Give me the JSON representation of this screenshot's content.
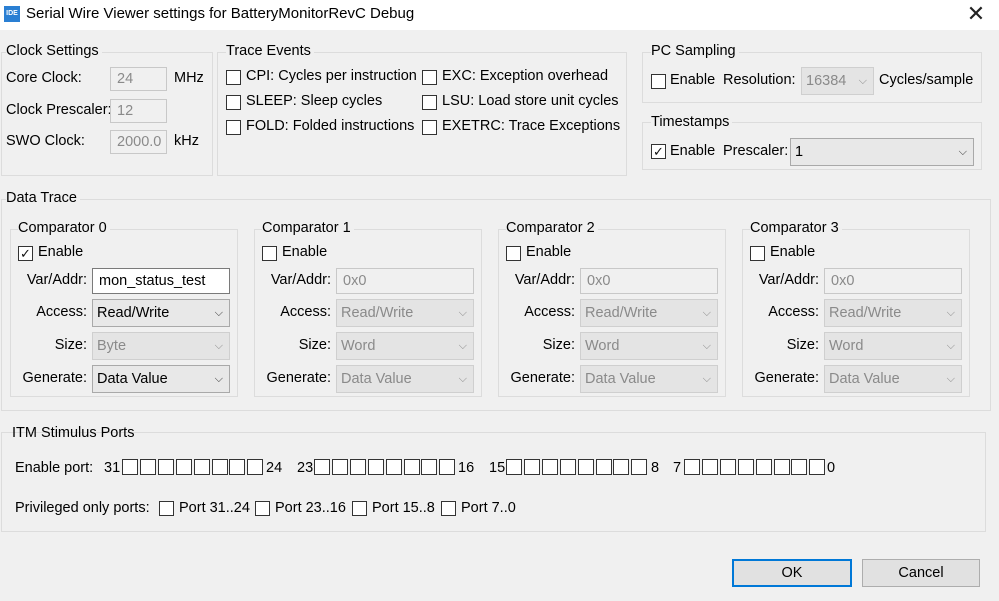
{
  "window": {
    "title": "Serial Wire Viewer settings for BatteryMonitorRevC Debug",
    "icon_text": "IDE"
  },
  "clock": {
    "title": "Clock Settings",
    "core_label": "Core Clock:",
    "core_value": "24",
    "core_unit": "MHz",
    "prescaler_label": "Clock Prescaler:",
    "prescaler_value": "12",
    "swo_label": "SWO Clock:",
    "swo_value": "2000.0",
    "swo_unit": "kHz"
  },
  "trace_events": {
    "title": "Trace Events",
    "items": [
      {
        "label": "CPI: Cycles per instruction",
        "checked": false
      },
      {
        "label": "SLEEP: Sleep cycles",
        "checked": false
      },
      {
        "label": "FOLD: Folded instructions",
        "checked": false
      },
      {
        "label": "EXC: Exception overhead",
        "checked": false
      },
      {
        "label": "LSU: Load store unit cycles",
        "checked": false
      },
      {
        "label": "EXETRC: Trace Exceptions",
        "checked": false
      }
    ]
  },
  "pc_sampling": {
    "title": "PC Sampling",
    "enable_label": "Enable",
    "enabled": false,
    "resolution_label": "Resolution:",
    "resolution_value": "16384",
    "unit": "Cycles/sample"
  },
  "timestamps": {
    "title": "Timestamps",
    "enable_label": "Enable",
    "enabled": true,
    "prescaler_label": "Prescaler:",
    "prescaler_value": "1"
  },
  "data_trace": {
    "title": "Data Trace",
    "comparators": [
      {
        "title": "Comparator 0",
        "enable_label": "Enable",
        "enabled": true,
        "var_label": "Var/Addr:",
        "var_value": "mon_status_test",
        "access_label": "Access:",
        "access_value": "Read/Write",
        "size_label": "Size:",
        "size_value": "Byte",
        "generate_label": "Generate:",
        "generate_value": "Data Value"
      },
      {
        "title": "Comparator 1",
        "enable_label": "Enable",
        "enabled": false,
        "var_label": "Var/Addr:",
        "var_value": "0x0",
        "access_label": "Access:",
        "access_value": "Read/Write",
        "size_label": "Size:",
        "size_value": "Word",
        "generate_label": "Generate:",
        "generate_value": "Data Value"
      },
      {
        "title": "Comparator 2",
        "enable_label": "Enable",
        "enabled": false,
        "var_label": "Var/Addr:",
        "var_value": "0x0",
        "access_label": "Access:",
        "access_value": "Read/Write",
        "size_label": "Size:",
        "size_value": "Word",
        "generate_label": "Generate:",
        "generate_value": "Data Value"
      },
      {
        "title": "Comparator 3",
        "enable_label": "Enable",
        "enabled": false,
        "var_label": "Var/Addr:",
        "var_value": "0x0",
        "access_label": "Access:",
        "access_value": "Read/Write",
        "size_label": "Size:",
        "size_value": "Word",
        "generate_label": "Generate:",
        "generate_value": "Data Value"
      }
    ]
  },
  "itm": {
    "title": "ITM Stimulus Ports",
    "enable_port_label": "Enable port:",
    "port_groups": [
      {
        "start": "31",
        "end": "24"
      },
      {
        "start": "23",
        "end": "16"
      },
      {
        "start": "15",
        "end": "8"
      },
      {
        "start": "7",
        "end": "0"
      }
    ],
    "privileged_label": "Privileged only ports:",
    "privileged": [
      {
        "label": "Port 31..24",
        "checked": false
      },
      {
        "label": "Port 23..16",
        "checked": false
      },
      {
        "label": "Port 15..8",
        "checked": false
      },
      {
        "label": "Port 7..0",
        "checked": false
      }
    ]
  },
  "buttons": {
    "ok": "OK",
    "cancel": "Cancel"
  },
  "icons": {
    "check": "✓",
    "chevron": "⌵",
    "close": "✕"
  },
  "colors": {
    "accent": "#0078d7",
    "background": "#f0f0f0"
  }
}
